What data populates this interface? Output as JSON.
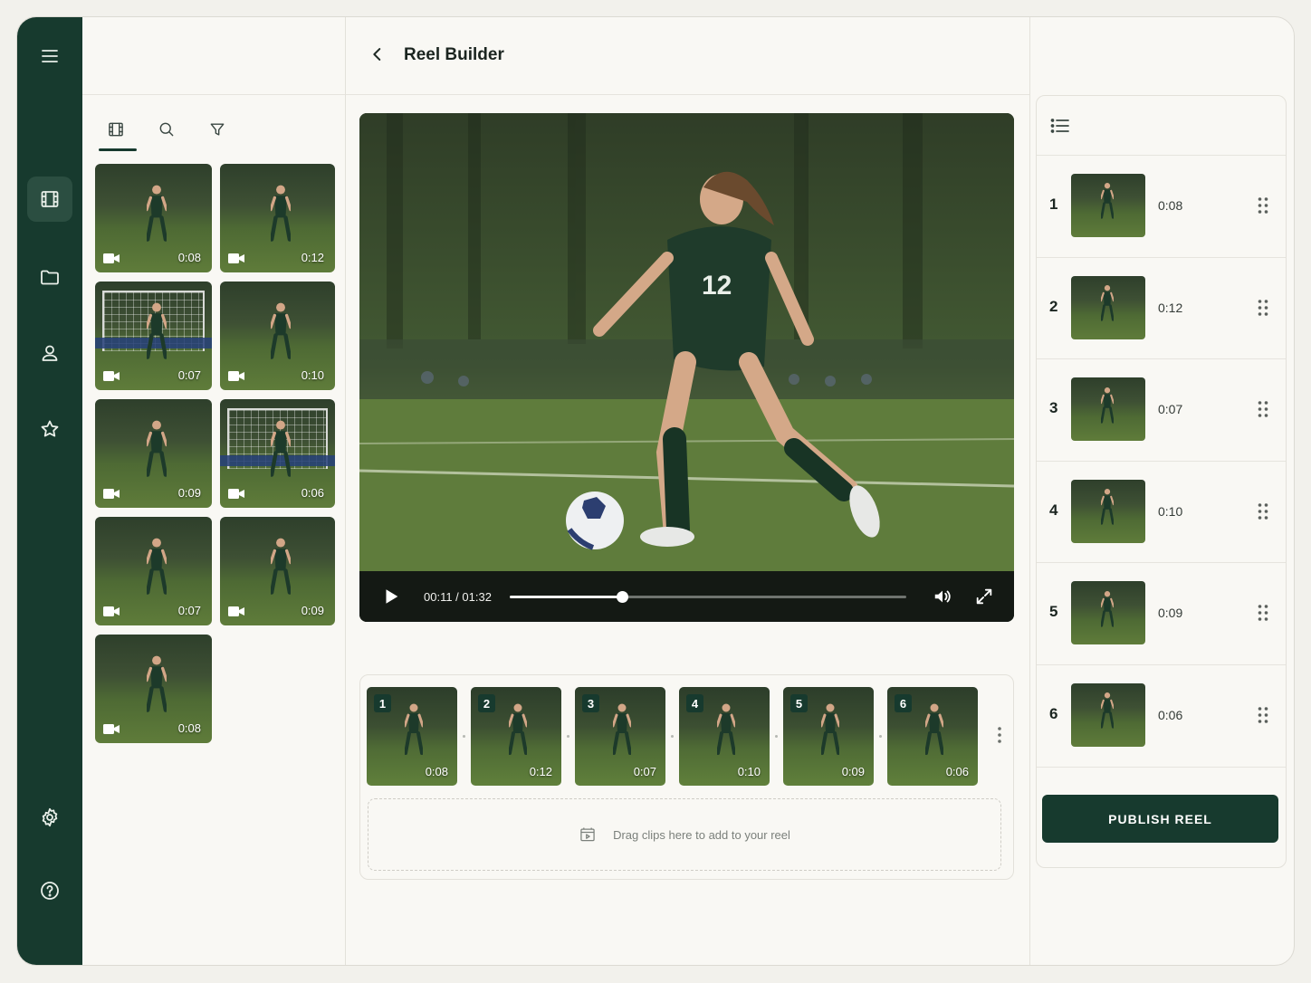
{
  "header": {
    "title": "Reel Builder",
    "back_icon": "chevron-left-icon"
  },
  "rail": {
    "items": [
      {
        "name": "menu",
        "icon": "menu-icon"
      },
      {
        "name": "clips",
        "icon": "film-icon",
        "active": true
      },
      {
        "name": "folders",
        "icon": "folder-icon"
      },
      {
        "name": "profile",
        "icon": "user-icon"
      },
      {
        "name": "favorites",
        "icon": "star-icon"
      },
      {
        "name": "settings",
        "icon": "gear-icon"
      },
      {
        "name": "help",
        "icon": "help-icon"
      }
    ]
  },
  "library": {
    "tabs": [
      {
        "name": "clips",
        "icon": "film-icon",
        "active": true
      },
      {
        "name": "search",
        "icon": "search-icon"
      },
      {
        "name": "filter",
        "icon": "filter-icon"
      }
    ],
    "clips": [
      {
        "duration": "0:08",
        "scene": "field"
      },
      {
        "duration": "0:12",
        "scene": "field"
      },
      {
        "duration": "0:07",
        "scene": "goal"
      },
      {
        "duration": "0:10",
        "scene": "field"
      },
      {
        "duration": "0:09",
        "scene": "field"
      },
      {
        "duration": "0:06",
        "scene": "goal"
      },
      {
        "duration": "0:07",
        "scene": "field"
      },
      {
        "duration": "0:09",
        "scene": "field"
      },
      {
        "duration": "0:08",
        "scene": "field"
      }
    ]
  },
  "player": {
    "time": "00:11 / 01:32",
    "progress": 0.283,
    "jersey_number": "12"
  },
  "timeline": {
    "clips": [
      {
        "number": "1",
        "duration": "0:08"
      },
      {
        "number": "2",
        "duration": "0:12"
      },
      {
        "number": "3",
        "duration": "0:07"
      },
      {
        "number": "4",
        "duration": "0:10"
      },
      {
        "number": "5",
        "duration": "0:09"
      },
      {
        "number": "6",
        "duration": "0:06"
      }
    ],
    "dropzone_text": "Drag clips here to add to your reel"
  },
  "sequence": {
    "items": [
      {
        "number": "1",
        "duration": "0:08"
      },
      {
        "number": "2",
        "duration": "0:12"
      },
      {
        "number": "3",
        "duration": "0:07"
      },
      {
        "number": "4",
        "duration": "0:10"
      },
      {
        "number": "5",
        "duration": "0:09"
      },
      {
        "number": "6",
        "duration": "0:06"
      }
    ],
    "publish_label": "PUBLISH REEL"
  },
  "colors": {
    "brand": "#173a2e",
    "background": "#f9f8f4"
  }
}
